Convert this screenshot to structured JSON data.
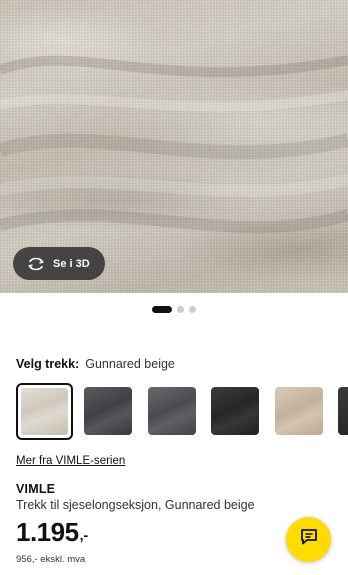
{
  "hero": {
    "view_3d_label": "Se i 3D",
    "view_3d_icon": "rotate-3d-icon",
    "carousel_pages": 3,
    "carousel_active_index": 0
  },
  "selector": {
    "label": "Velg trekk:",
    "selected_value": "Gunnared beige",
    "swatches": [
      {
        "name": "Gunnared beige",
        "color": "#d4cfc5",
        "selected": true
      },
      {
        "name": "dark grey",
        "color": "#4a4c50",
        "selected": false
      },
      {
        "name": "medium grey",
        "color": "#55575a",
        "selected": false
      },
      {
        "name": "black",
        "color": "#2e2f31",
        "selected": false
      },
      {
        "name": "beige",
        "color": "#c9b8a2",
        "selected": false
      },
      {
        "name": "dark",
        "color": "#2a2a2a",
        "selected": false
      }
    ]
  },
  "series_link": "Mer fra VIMLE-serien",
  "product": {
    "name": "VIMLE",
    "description": "Trekk til sjeselongseksjon, Gunnared beige",
    "price": "1.195",
    "price_suffix": ",-",
    "ex_vat": "956,- ekskl. mva"
  },
  "chat": {
    "icon": "chat-icon"
  },
  "colors": {
    "accent_yellow": "#ffdb00"
  }
}
